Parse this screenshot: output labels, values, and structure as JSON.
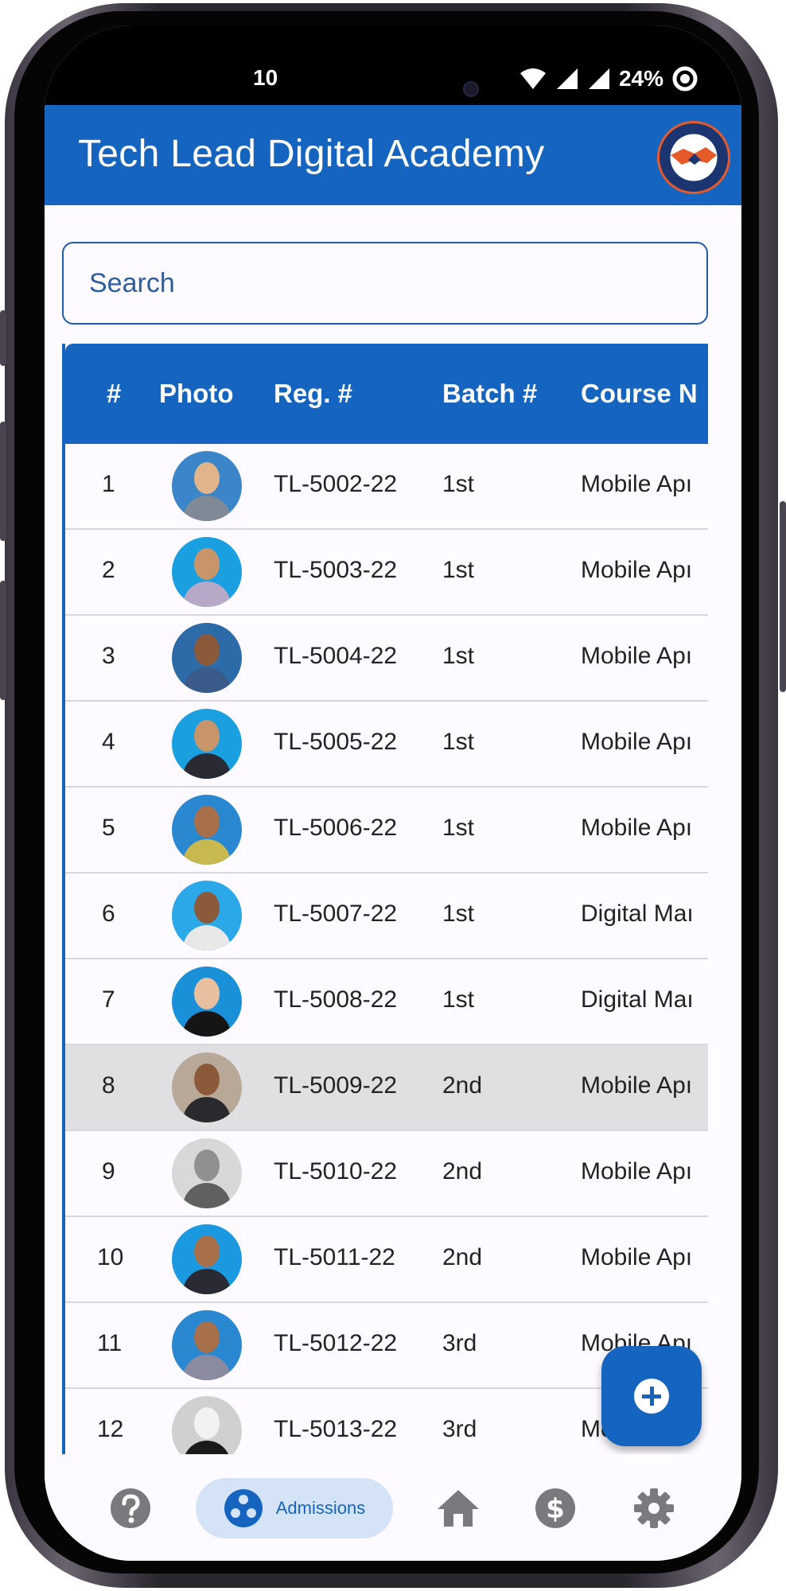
{
  "status_bar": {
    "time": "10",
    "battery": "24%"
  },
  "app_bar": {
    "title": "Tech Lead Digital Academy"
  },
  "search": {
    "placeholder": "Search"
  },
  "table": {
    "headers": [
      "#",
      "Photo",
      "Reg. #",
      "Batch #",
      "Course N"
    ],
    "rows": [
      {
        "no": "1",
        "reg": "TL-5002-22",
        "batch": "1st",
        "course": "Mobile Apı"
      },
      {
        "no": "2",
        "reg": "TL-5003-22",
        "batch": "1st",
        "course": "Mobile Apı"
      },
      {
        "no": "3",
        "reg": "TL-5004-22",
        "batch": "1st",
        "course": "Mobile Apı"
      },
      {
        "no": "4",
        "reg": "TL-5005-22",
        "batch": "1st",
        "course": "Mobile Apı"
      },
      {
        "no": "5",
        "reg": "TL-5006-22",
        "batch": "1st",
        "course": "Mobile Apı"
      },
      {
        "no": "6",
        "reg": "TL-5007-22",
        "batch": "1st",
        "course": "Digital Maı"
      },
      {
        "no": "7",
        "reg": "TL-5008-22",
        "batch": "1st",
        "course": "Digital Maı"
      },
      {
        "no": "8",
        "reg": "TL-5009-22",
        "batch": "2nd",
        "course": "Mobile Apı"
      },
      {
        "no": "9",
        "reg": "TL-5010-22",
        "batch": "2nd",
        "course": "Mobile Apı"
      },
      {
        "no": "10",
        "reg": "TL-5011-22",
        "batch": "2nd",
        "course": "Mobile Apı"
      },
      {
        "no": "11",
        "reg": "TL-5012-22",
        "batch": "3rd",
        "course": "Mobile Apı"
      },
      {
        "no": "12",
        "reg": "TL-5013-22",
        "batch": "3rd",
        "course": "Mobile Apı"
      }
    ]
  },
  "fab": {
    "icon": "add-circle-icon"
  },
  "bottom_nav": {
    "items": [
      {
        "icon": "help-icon"
      },
      {
        "icon": "admissions-icon",
        "label": "Admissions",
        "active": true
      },
      {
        "icon": "home-icon"
      },
      {
        "icon": "dollar-icon"
      },
      {
        "icon": "settings-icon"
      }
    ]
  }
}
